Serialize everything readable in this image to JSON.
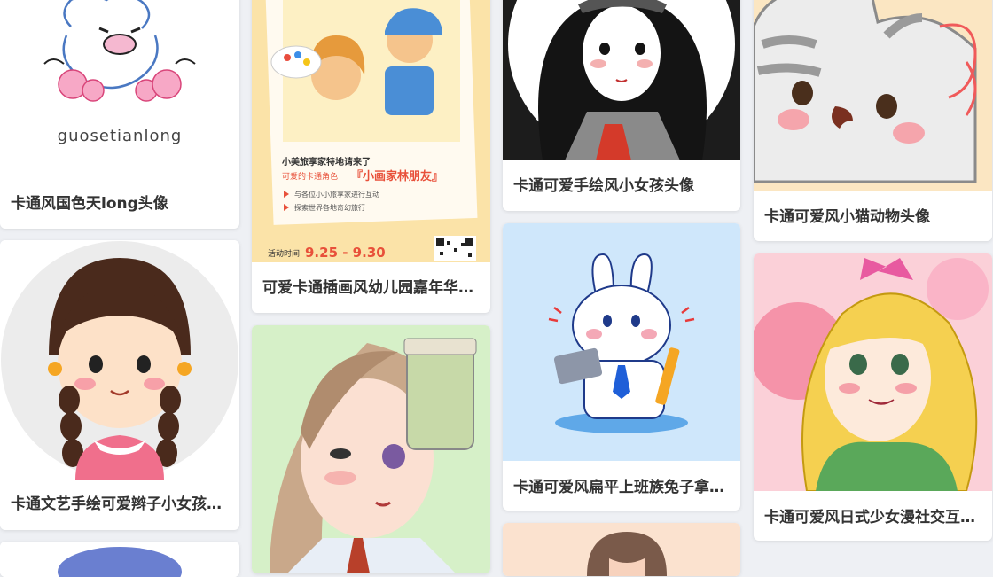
{
  "cards": [
    {
      "title": "卡通风国色天long头像",
      "image_text": "guosetianlong"
    },
    {
      "title": "卡通文艺手绘可爱辫子小女孩…"
    },
    {
      "title": "可爱卡通插画风幼儿园嘉年华…",
      "poster": {
        "line1": "小美旅享家特地请来了",
        "line2_prefix": "可爱的卡通角色",
        "line2_highlight": "『小画家林朋友』",
        "bullet1": "与各位小小旅享家进行互动",
        "bullet2": "探索世界各地奇幻旅行",
        "time_label": "活动时间",
        "time_value": "9.25 - 9.30"
      }
    },
    {
      "title": ""
    },
    {
      "title": "卡通可爱手绘风小女孩头像"
    },
    {
      "title": "卡通可爱风扁平上班族兔子拿…"
    },
    {
      "title": ""
    },
    {
      "title": "卡通可爱风小猫动物头像"
    },
    {
      "title": "卡通可爱风日式少女漫社交互…"
    }
  ],
  "colors": {
    "card_bg": "#ffffff",
    "page_bg": "#eef0f4",
    "title_text": "#333333",
    "poster_accent": "#e8503a"
  }
}
